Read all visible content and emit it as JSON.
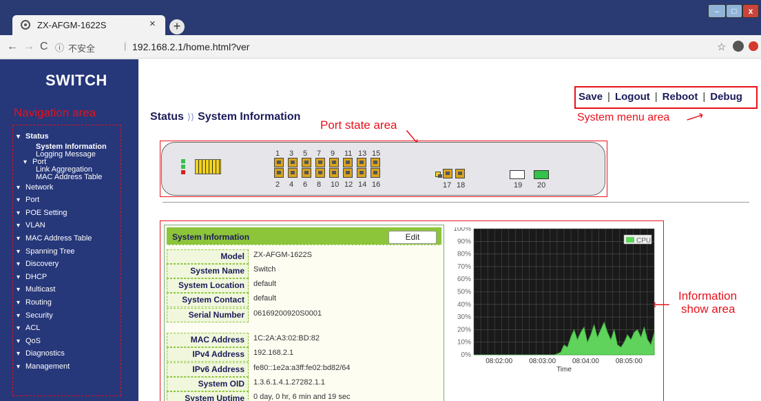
{
  "browser": {
    "tab_title": "ZX-AFGM-1622S",
    "tab_close": "×",
    "new_tab": "+",
    "security": "不安全",
    "url": "192.168.2.1/home.html?ver",
    "nav_back": "←",
    "nav_forward": "→",
    "nav_reload": "C",
    "info_icon": "ⓘ",
    "star_icon": "☆",
    "win_min": "–",
    "win_max": "□",
    "win_close": "x"
  },
  "brand": "SWITCH",
  "annotations": {
    "navigation": "Navigation area",
    "system_menu": "System menu area",
    "port_state": "Port state area",
    "information_line1": "Information",
    "information_line2": "show area"
  },
  "system_menu": [
    "Save",
    "Logout",
    "Reboot",
    "Debug"
  ],
  "breadcrumb": {
    "parent": "Status",
    "current": "System Information"
  },
  "sidebar": {
    "status": "Status",
    "status_children": [
      "System Information",
      "Logging Message"
    ],
    "port_sub": "Port",
    "port_children": [
      "Link Aggregation",
      "MAC Address Table"
    ],
    "items": [
      "Network",
      "Port",
      "POE Setting",
      "VLAN",
      "MAC Address Table",
      "Spanning Tree",
      "Discovery",
      "DHCP",
      "Multicast",
      "Routing",
      "Security",
      "ACL",
      "QoS",
      "Diagnostics",
      "Management"
    ]
  },
  "ports": {
    "top_numbers": [
      "1",
      "3",
      "5",
      "7",
      "9",
      "11",
      "13",
      "15"
    ],
    "bottom_numbers": [
      "2",
      "4",
      "6",
      "8",
      "10",
      "12",
      "14",
      "16"
    ],
    "combo_numbers": [
      "17",
      "18"
    ],
    "sfp_numbers": [
      "19",
      "20"
    ],
    "sfp_status": [
      "down",
      "up"
    ]
  },
  "sysinfo": {
    "title": "System Information",
    "edit": "Edit",
    "rows": [
      {
        "label": "Model",
        "value": "ZX-AFGM-1622S"
      },
      {
        "label": "System Name",
        "value": "Switch"
      },
      {
        "label": "System Location",
        "value": "default"
      },
      {
        "label": "System Contact",
        "value": "default"
      },
      {
        "label": "Serial Number",
        "value": "06169200920S0001"
      },
      {
        "label": "MAC Address",
        "value": "1C:2A:A3:02:BD:82"
      },
      {
        "label": "IPv4 Address",
        "value": "192.168.2.1"
      },
      {
        "label": "IPv6 Address",
        "value": "fe80::1e2a:a3ff:fe02:bd82/64"
      },
      {
        "label": "System OID",
        "value": "1.3.6.1.4.1.27282.1.1"
      },
      {
        "label": "System Uptime",
        "value": "0 day, 0 hr, 6 min and 19 sec"
      }
    ]
  },
  "chart_data": {
    "type": "area",
    "legend": "CPU",
    "xlabel": "Time",
    "y_ticks": [
      "0%",
      "10%",
      "20%",
      "30%",
      "40%",
      "50%",
      "60%",
      "70%",
      "80%",
      "90%",
      "100%"
    ],
    "x_ticks": [
      "08:02:00",
      "08:03:00",
      "08:04:00",
      "08:05:00"
    ],
    "ylim": [
      0,
      100
    ],
    "values": [
      0,
      0,
      0,
      0,
      0,
      0,
      0,
      0,
      0,
      0,
      0,
      0,
      0,
      0,
      0,
      0,
      0,
      0,
      0,
      0,
      0,
      0,
      0,
      0,
      0,
      1,
      2,
      8,
      6,
      14,
      20,
      12,
      18,
      22,
      10,
      16,
      24,
      14,
      20,
      26,
      18,
      12,
      20,
      8,
      6,
      10,
      16,
      12,
      18,
      20,
      14,
      22,
      12,
      8,
      18
    ],
    "colors": {
      "area": "#5fd35b",
      "background": "#1a1a1a",
      "grid": "#555555"
    }
  }
}
